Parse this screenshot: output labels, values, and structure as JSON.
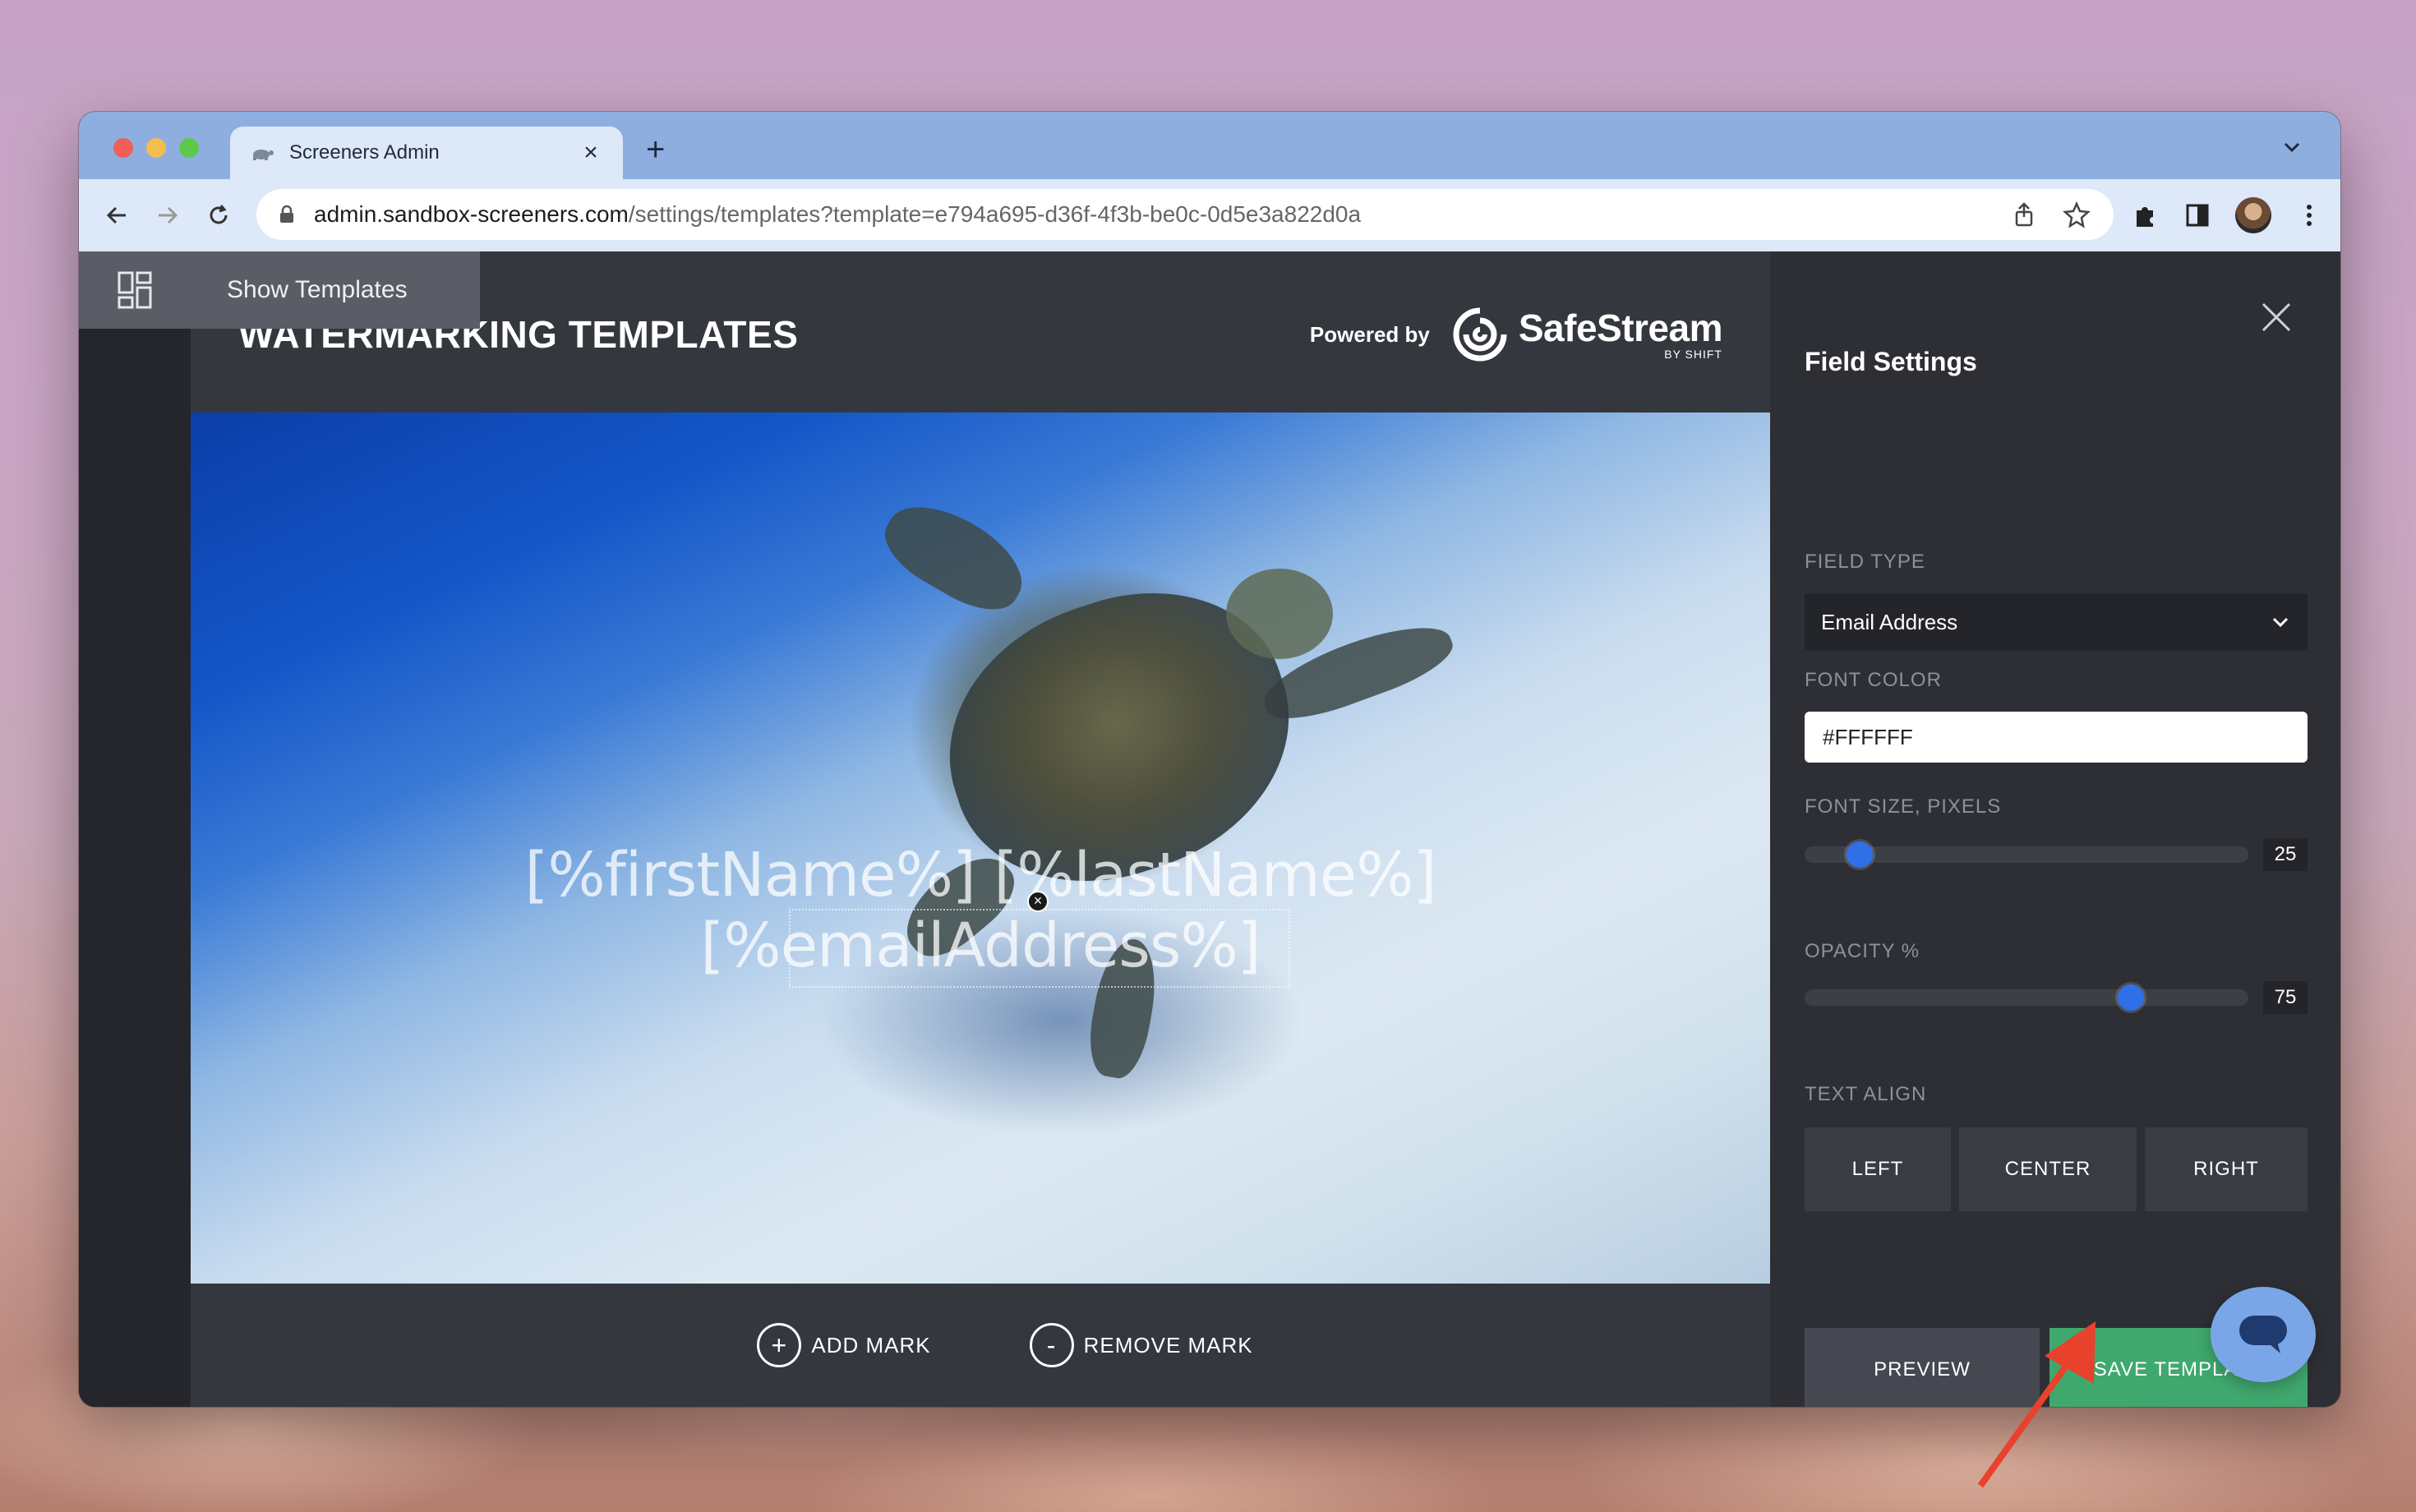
{
  "browser": {
    "tab_title": "Screeners Admin",
    "new_tab_label": "+",
    "url_host": "admin.sandbox-screeners.com",
    "url_path": "/settings/templates?template=e794a695-d36f-4f3b-be0c-0d5e3a822d0a"
  },
  "sidebar": {
    "show_templates_label": "Show Templates"
  },
  "header": {
    "title": "WATERMARKING TEMPLATES",
    "powered_by": "Powered by",
    "brand_name": "SafeStream",
    "brand_sub": "BY SHIFT"
  },
  "preview": {
    "watermark_line1": "[%firstName%] [%lastName%]",
    "watermark_line2": "[%emailAddress%]",
    "add_mark": "ADD MARK",
    "remove_mark": "REMOVE MARK",
    "add_symbol": "+",
    "remove_symbol": "-"
  },
  "panel": {
    "title": "Field Settings",
    "field_type_label": "FIELD TYPE",
    "field_type_value": "Email Address",
    "font_color_label": "FONT COLOR",
    "font_color_value": "#FFFFFF",
    "font_size_label": "FONT SIZE, PIXELS",
    "font_size_value": "25",
    "font_size_fraction": 0.1,
    "opacity_label": "OPACITY %",
    "opacity_value": "75",
    "opacity_fraction": 0.75,
    "text_align_label": "TEXT ALIGN",
    "align_left": "LEFT",
    "align_center": "CENTER",
    "align_right": "RIGHT",
    "preview_button": "PREVIEW",
    "save_button": "SAVE TEMPLATE"
  },
  "colors": {
    "accent_blue": "#2f6fe8",
    "save_green": "#3fa86e",
    "annotation_arrow": "#e8412c"
  }
}
